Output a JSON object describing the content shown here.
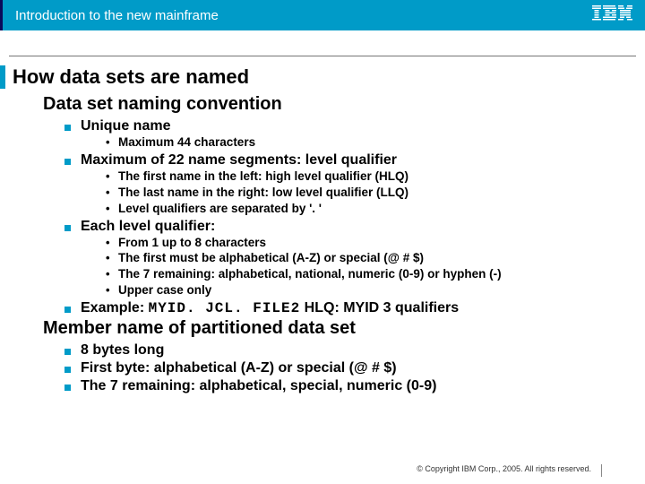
{
  "header": {
    "title": "Introduction to the new mainframe",
    "logo_name": "ibm-logo"
  },
  "slide": {
    "title": "How data sets are named",
    "section1": {
      "heading": "Data set naming convention",
      "b1": {
        "label": "Unique name",
        "sub": [
          "Maximum 44 characters"
        ]
      },
      "b2": {
        "label": "Maximum of 22 name segments: level qualifier",
        "sub": [
          "The first name in the left: high level qualifier (HLQ)",
          "The last name in the right: low level qualifier (LLQ)",
          "Level qualifiers are separated by '. '"
        ]
      },
      "b3": {
        "label": "Each level qualifier:",
        "sub": [
          "From 1 up to 8 characters",
          "The first must be alphabetical (A-Z) or special (@ # $)",
          "The 7 remaining:  alphabetical, national, numeric (0-9) or hyphen  (-)",
          "Upper case only"
        ]
      },
      "b4": {
        "prefix": "Example: ",
        "code": "MYID. JCL. FILE2",
        "mid": "  HLQ: MYID",
        "tail": "  3 qualifiers"
      }
    },
    "section2": {
      "heading": "Member name of partitioned data set",
      "items": [
        "8 bytes long",
        "First byte: alphabetical (A-Z) or special (@ # $)",
        "The 7 remaining:  alphabetical, special, numeric (0-9)"
      ]
    }
  },
  "footer": "© Copyright IBM Corp., 2005. All rights reserved."
}
